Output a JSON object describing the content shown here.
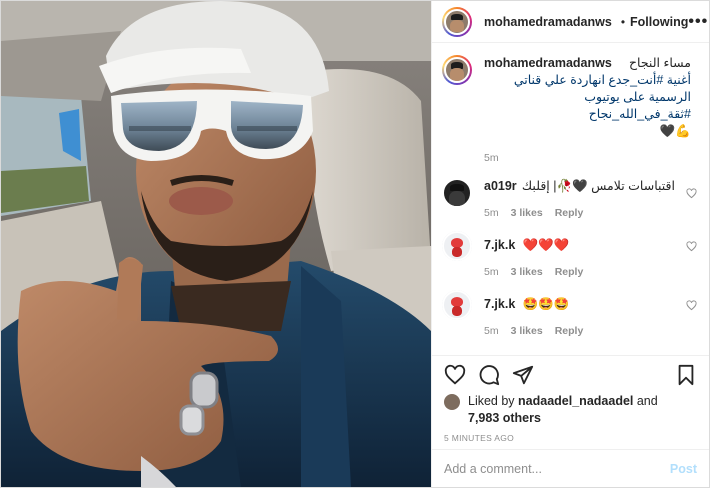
{
  "header": {
    "username": "mohamedramadanws",
    "separator": "•",
    "follow_label": "Following",
    "more_label": "•••"
  },
  "caption": {
    "username": "mohamedramadanws",
    "line1": "مساء النجاح",
    "line2": "أغنية #أنت_جدع انهاردة علي قناتي",
    "line3": "الرسمية على يوتيوب #ثقة_في_الله_نجاح",
    "line4": "💪🖤",
    "time": "5m"
  },
  "comments": [
    {
      "username": "a019r",
      "text": "اقتباسات تلامس 🖤🥀| إقلبك",
      "time": "5m",
      "likes": "3 likes",
      "reply_label": "Reply"
    },
    {
      "username": "7.jk.k",
      "text": "❤️❤️❤️",
      "time": "5m",
      "likes": "3 likes",
      "reply_label": "Reply"
    },
    {
      "username": "7.jk.k",
      "text": "🤩🤩🤩",
      "time": "5m",
      "likes": "3 likes",
      "reply_label": "Reply"
    }
  ],
  "likes": {
    "prefix": "Liked by",
    "user": "nadaadel_nadaadel",
    "and": "and",
    "others": "7,983 others"
  },
  "timestamp": "5 MINUTES AGO",
  "add_comment": {
    "placeholder": "Add a comment...",
    "post_label": "Post"
  },
  "colors": {
    "link": "#00376b",
    "muted": "#8e8e8e",
    "verified": "#3897f0",
    "post_disabled": "#b2dffc"
  },
  "icons": [
    "heart-icon",
    "comment-icon",
    "share-icon",
    "bookmark-icon",
    "verified-badge-icon",
    "more-icon"
  ]
}
